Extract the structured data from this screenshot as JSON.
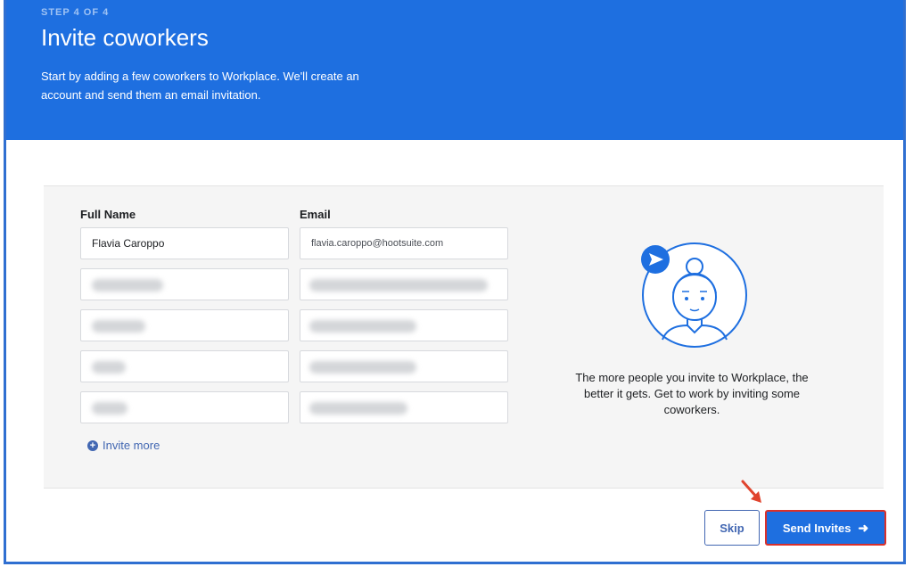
{
  "header": {
    "step": "STEP 4 OF 4",
    "title": "Invite coworkers",
    "subtitle": "Start by adding a few coworkers to Workplace. We'll create an account and send them an email invitation."
  },
  "form": {
    "name_label": "Full Name",
    "email_label": "Email",
    "rows": [
      {
        "name": "Flavia Caroppo",
        "email": "flavia.caroppo@hootsuite.com"
      },
      {
        "name": "",
        "email": ""
      },
      {
        "name": "",
        "email": ""
      },
      {
        "name": "",
        "email": ""
      },
      {
        "name": "",
        "email": ""
      }
    ],
    "invite_more": "Invite more"
  },
  "info": {
    "blurb": "The more people you invite to Workplace, the better it gets. Get to work by inviting some coworkers."
  },
  "actions": {
    "skip": "Skip",
    "send": "Send Invites"
  },
  "colors": {
    "brand": "#1e6fe0",
    "highlight": "#d9302b"
  }
}
